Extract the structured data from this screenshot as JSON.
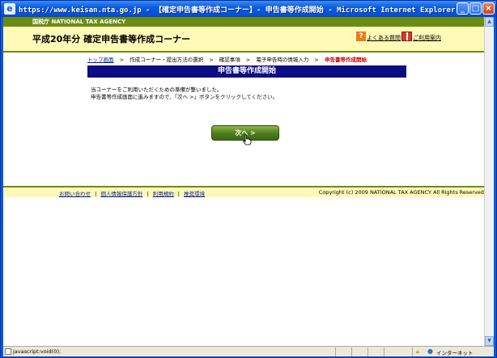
{
  "window": {
    "title": "https://www.keisan.nta.go.jp - 【確定申告書等作成コーナー】- 申告書等作成開始 - Microsoft Internet Explorer",
    "buttons": {
      "minimize": "_",
      "maximize": "□",
      "close": "×"
    }
  },
  "agency": {
    "name": "国税庁 NATIONAL TAX AGENCY"
  },
  "header": {
    "title": "平成20年分 確定申告書等作成コーナー",
    "faq_label": "よくある質問",
    "guide_label": "ご利用案内"
  },
  "breadcrumb": {
    "items": [
      "トップ画面",
      "作成コーナー・提出方法の選択",
      "確認事項",
      "電子申告時の情報入力",
      "申告書等作成開始"
    ],
    "separator": ">"
  },
  "main": {
    "heading": "申告書等作成開始",
    "message_line1": "当コーナーをご利用いただくための準備が整いました。",
    "message_line2": "申告書等作成画面に進みますので、「次へ >」ボタンをクリックしてください。",
    "next_button": "次へ >"
  },
  "footer": {
    "links": [
      "お問い合わせ",
      "個人情報保護方針",
      "利用規約",
      "推奨環境"
    ],
    "link_separator": "|",
    "copyright": "Copyright (c) 2009 NATIONAL TAX AGENCY All Rights Reserved."
  },
  "statusbar": {
    "text": "javascript:void(0);",
    "zone": "インターネット"
  },
  "colors": {
    "agency_bar": "#6b8c14",
    "header_bg": "#fff9b8",
    "heading_bg": "#0c0c84",
    "current_crumb": "#cc0000",
    "next_button": "#4c7a1c"
  },
  "icons": [
    "ie-icon",
    "faq-icon",
    "guide-icon",
    "hand-cursor-icon",
    "lock-icon",
    "internet-zone-icon"
  ]
}
